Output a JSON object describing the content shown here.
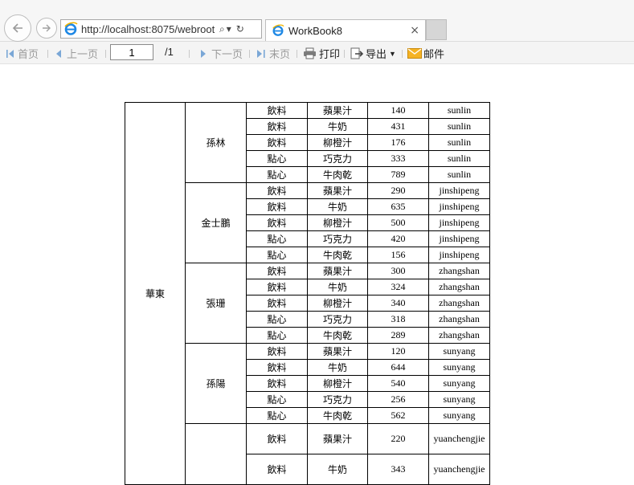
{
  "browser": {
    "url": "http://localhost:8075/webroot",
    "tab_title": "WorkBook8",
    "tab_close": "×",
    "search_glyph": "⌕",
    "dropdown_glyph": "▾",
    "refresh_glyph": "↻"
  },
  "toolbar": {
    "first": "首页",
    "prev": "上一页",
    "page_value": "1",
    "page_total": "/1",
    "next": "下一页",
    "last": "末页",
    "print": "打印",
    "export": "导出",
    "mail": "邮件"
  },
  "report": {
    "region": "華東",
    "groups": [
      {
        "person": "孫林",
        "rows": [
          [
            "飲料",
            "蘋果汁",
            "140",
            "sunlin"
          ],
          [
            "飲料",
            "牛奶",
            "431",
            "sunlin"
          ],
          [
            "飲料",
            "柳橙汁",
            "176",
            "sunlin"
          ],
          [
            "點心",
            "巧克力",
            "333",
            "sunlin"
          ],
          [
            "點心",
            "牛肉乾",
            "789",
            "sunlin"
          ]
        ]
      },
      {
        "person": "金士鵬",
        "rows": [
          [
            "飲料",
            "蘋果汁",
            "290",
            "jinshipeng"
          ],
          [
            "飲料",
            "牛奶",
            "635",
            "jinshipeng"
          ],
          [
            "飲料",
            "柳橙汁",
            "500",
            "jinshipeng"
          ],
          [
            "點心",
            "巧克力",
            "420",
            "jinshipeng"
          ],
          [
            "點心",
            "牛肉乾",
            "156",
            "jinshipeng"
          ]
        ]
      },
      {
        "person": "張珊",
        "rows": [
          [
            "飲料",
            "蘋果汁",
            "300",
            "zhangshan"
          ],
          [
            "飲料",
            "牛奶",
            "324",
            "zhangshan"
          ],
          [
            "飲料",
            "柳橙汁",
            "340",
            "zhangshan"
          ],
          [
            "點心",
            "巧克力",
            "318",
            "zhangshan"
          ],
          [
            "點心",
            "牛肉乾",
            "289",
            "zhangshan"
          ]
        ]
      },
      {
        "person": "孫陽",
        "rows": [
          [
            "飲料",
            "蘋果汁",
            "120",
            "sunyang"
          ],
          [
            "飲料",
            "牛奶",
            "644",
            "sunyang"
          ],
          [
            "飲料",
            "柳橙汁",
            "540",
            "sunyang"
          ],
          [
            "點心",
            "巧克力",
            "256",
            "sunyang"
          ],
          [
            "點心",
            "牛肉乾",
            "562",
            "sunyang"
          ]
        ]
      },
      {
        "person": "",
        "rows": [
          [
            "飲料",
            "蘋果汁",
            "220",
            "yuanchengjie"
          ],
          [
            "飲料",
            "牛奶",
            "343",
            "yuanchengjie"
          ]
        ]
      }
    ]
  }
}
